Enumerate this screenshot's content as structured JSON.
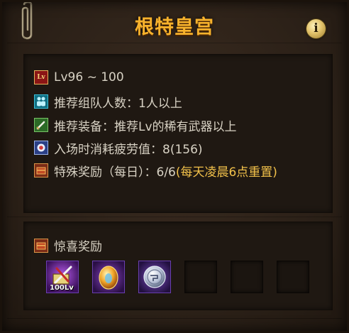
{
  "window": {
    "title": "根特皇宫",
    "info_glyph": "i"
  },
  "info": {
    "rows": [
      {
        "icon": "level-icon",
        "icon_text": "Lv",
        "text": "Lv96 ~ 100",
        "highlight": ""
      },
      {
        "icon": "party-icon",
        "text": "推荐组队人数：1人以上",
        "highlight": ""
      },
      {
        "icon": "equipment-icon",
        "text": "推荐装备：推荐Lv的稀有武器以上",
        "highlight": ""
      },
      {
        "icon": "fatigue-icon",
        "text": "入场时消耗疲劳值：8(156)",
        "highlight": ""
      },
      {
        "icon": "chest-icon",
        "text": "特殊奖励（每日）：6/6",
        "highlight": "(每天凌晨6点重置)"
      }
    ]
  },
  "bonus": {
    "title": "惊喜奖励",
    "items": [
      {
        "icon": "weapon-box-icon",
        "badge": "100Lv",
        "state": "filled"
      },
      {
        "icon": "golden-egg-icon",
        "badge": "",
        "state": "filled"
      },
      {
        "icon": "silver-coin-icon",
        "badge": "",
        "state": "filled"
      },
      {
        "icon": "",
        "badge": "",
        "state": "empty"
      },
      {
        "icon": "",
        "badge": "",
        "state": "empty"
      },
      {
        "icon": "",
        "badge": "",
        "state": "empty"
      }
    ]
  }
}
